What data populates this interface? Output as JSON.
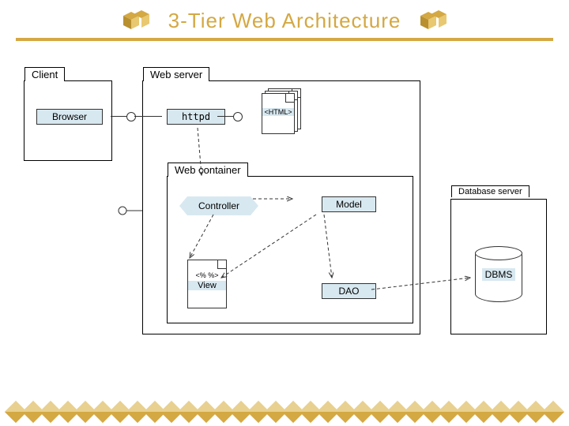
{
  "title": "3-Tier Web Architecture",
  "packages": {
    "client": {
      "label": "Client"
    },
    "webserver": {
      "label": "Web server"
    },
    "webcontainer": {
      "label": "Web container"
    },
    "dbserver": {
      "label": "Database server"
    }
  },
  "components": {
    "browser": "Browser",
    "httpd": "httpd",
    "html": "<HTML>",
    "controller": "Controller",
    "model": "Model",
    "dao": "DAO",
    "view_stereo": "<% %>",
    "view": "View",
    "dbms": "DBMS"
  }
}
